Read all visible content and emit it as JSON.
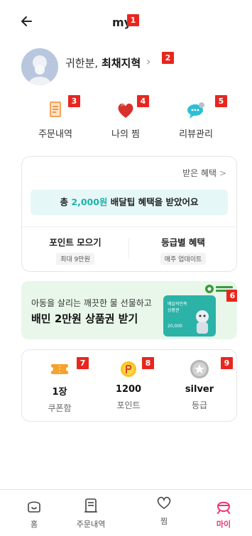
{
  "header": {
    "title": "my",
    "back_icon": "arrow-left-icon"
  },
  "profile": {
    "name_prefix": "귀한분,",
    "name": "최채지혁",
    "chevron": "›"
  },
  "quick_menu": [
    {
      "label": "주문내역",
      "icon": "order-history-icon"
    },
    {
      "label": "나의 찜",
      "icon": "heart-icon"
    },
    {
      "label": "리뷰관리",
      "icon": "review-bubble-icon"
    }
  ],
  "benefits": {
    "link_label": "받은 혜택",
    "link_chevron": ">",
    "tip_prefix": "총",
    "tip_amount": "2,000원",
    "tip_suffix": "배달팁 혜택을 받았어요",
    "columns": [
      {
        "title": "포인트 모으기",
        "chip": "최대 9만원"
      },
      {
        "title": "등급별 혜택",
        "chip": "매주 업데이트"
      }
    ]
  },
  "promo": {
    "line1": "아동을 살리는 깨끗한 물 선물하고",
    "line2": "배민 2만원 상품권 받기",
    "giftcard_title_1": "배달의민족",
    "giftcard_title_2": "상품권",
    "giftcard_amount": "20,000",
    "colors": {
      "background": "#e8f7ea",
      "card": "#2bb3a8"
    }
  },
  "stats": [
    {
      "value": "1장",
      "label": "쿠폰함",
      "icon": "coupon-icon"
    },
    {
      "value": "1200",
      "label": "포인트",
      "icon": "point-coin-icon"
    },
    {
      "value": "silver",
      "label": "등급",
      "icon": "grade-medal-icon"
    }
  ],
  "bottom_nav": [
    {
      "label": "홈",
      "icon": "home-icon",
      "active": false
    },
    {
      "label": "주문내역",
      "icon": "receipt-icon",
      "active": false
    },
    {
      "label": "찜",
      "icon": "heart-outline-icon",
      "active": false
    },
    {
      "label": "마이",
      "icon": "my-face-icon",
      "active": true
    }
  ],
  "markers": [
    "1",
    "2",
    "3",
    "4",
    "5",
    "6",
    "7",
    "8",
    "9"
  ],
  "colors": {
    "accent": "#1fb2ac",
    "active_nav": "#ef2f74",
    "badge": "#e8261e"
  }
}
